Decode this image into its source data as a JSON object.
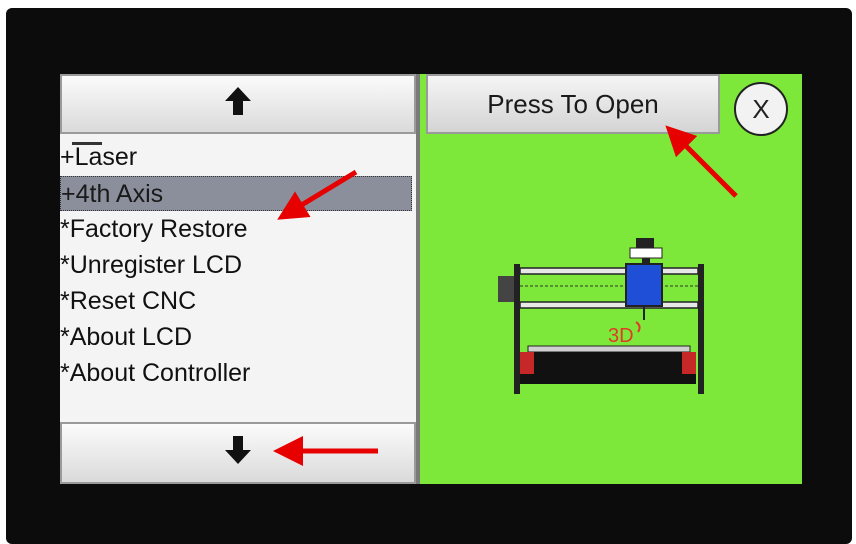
{
  "scroll": {
    "up_glyph": "🡑",
    "down_glyph": "🡓"
  },
  "menu": {
    "items": [
      {
        "label": "+Laser"
      },
      {
        "label": "+4th Axis",
        "selected": true
      },
      {
        "label": "*Factory Restore"
      },
      {
        "label": "*Unregister LCD"
      },
      {
        "label": "*Reset CNC"
      },
      {
        "label": "*About LCD"
      },
      {
        "label": "*About Controller"
      }
    ]
  },
  "preview": {
    "open_button_label": "Press To Open",
    "close_label": "X",
    "machine_label": "3D"
  },
  "colors": {
    "preview_bg": "#7de83a",
    "selected_row": "#8b8f9c",
    "annotation": "#e60000"
  }
}
